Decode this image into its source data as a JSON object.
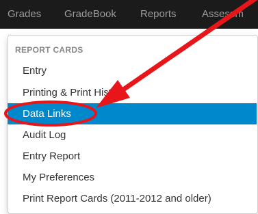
{
  "navbar": {
    "tabs": [
      {
        "label": "Grades"
      },
      {
        "label": "GradeBook"
      },
      {
        "label": "Reports"
      },
      {
        "label": "Assessm"
      }
    ]
  },
  "menu": {
    "header": "REPORT CARDS",
    "items": [
      {
        "label": "Entry"
      },
      {
        "label": "Printing & Print History"
      },
      {
        "label": "Data Links",
        "active": true
      },
      {
        "label": "Audit Log"
      },
      {
        "label": "Entry Report"
      },
      {
        "label": "My Preferences"
      },
      {
        "label": "Print Report Cards (2011-2012 and older)"
      }
    ]
  },
  "colors": {
    "navbar_bg": "#1b1b1b",
    "nav_text": "#9d9d9d",
    "active_item_bg": "#0088cc",
    "annotation_red": "#e8151b"
  }
}
